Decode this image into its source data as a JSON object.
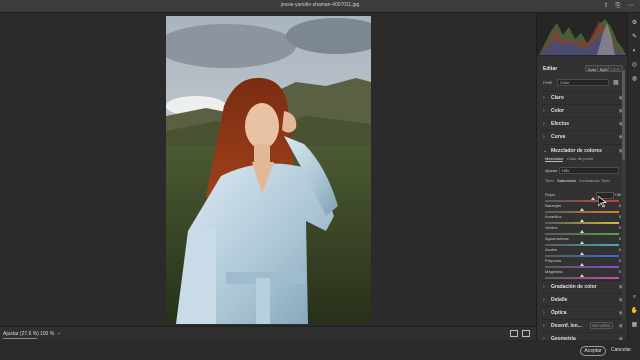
{
  "window": {
    "title": "jessie-yanidie-shaman-4007011.jpg"
  },
  "bottombar": {
    "zoom_fit": "Ajustar (27,6 %)",
    "zoom_100": "100 %",
    "chevron": "⌄"
  },
  "footer": {
    "accept": "Aceptar",
    "cancel": "Cancelar"
  },
  "panel": {
    "edit_title": "Editar",
    "auto_label": "Auto",
    "bw_label": "ByN",
    "hdr_label": "HDR",
    "profile_label": "Perfil",
    "profile_value": "Color",
    "sections_top": [
      "Claro",
      "Color",
      "Efectos",
      "Curva"
    ],
    "mixer": {
      "title": "Mezclador de colores",
      "tab_mixer": "Mezclador",
      "tab_points": "Color de punto",
      "adjust_label": "Ajustar",
      "adjust_value": "HSL",
      "subtabs": [
        "Tono",
        "Saturación",
        "Luminancia",
        "Todo"
      ],
      "sliders": [
        {
          "name": "Rojos",
          "value": "+30",
          "pos": 0.65,
          "color": "#c74040"
        },
        {
          "name": "Naranjas",
          "value": "0",
          "pos": 0.5,
          "color": "#d9822b"
        },
        {
          "name": "Amarillos",
          "value": "0",
          "pos": 0.5,
          "color": "#cfc23a"
        },
        {
          "name": "Verdes",
          "value": "0",
          "pos": 0.5,
          "color": "#4fa844"
        },
        {
          "name": "Aguamarinas",
          "value": "0",
          "pos": 0.5,
          "color": "#3fb3b0"
        },
        {
          "name": "Azules",
          "value": "0",
          "pos": 0.5,
          "color": "#3d6ad6"
        },
        {
          "name": "Púrpuras",
          "value": "0",
          "pos": 0.5,
          "color": "#8a4dd1"
        },
        {
          "name": "Magentas",
          "value": "0",
          "pos": 0.5,
          "color": "#c94bb3"
        }
      ]
    },
    "sections_bottom": [
      "Gradación de color",
      "Detalle",
      "Óptica",
      "Desenf. len...",
      "Geometría"
    ],
    "lens_badge": "EN VERS."
  },
  "colors": {
    "accent_white": "#e0e0e0",
    "panel_bg": "#323232",
    "canvas_bg": "#2b2b2b"
  },
  "icons": [
    "share-icon",
    "export-icon",
    "more-icon",
    "edit-icon",
    "heal-icon",
    "mask-icon",
    "redeye-icon",
    "presets-icon",
    "zoom-icon",
    "hand-icon",
    "grid-icon",
    "cursor-icon"
  ]
}
